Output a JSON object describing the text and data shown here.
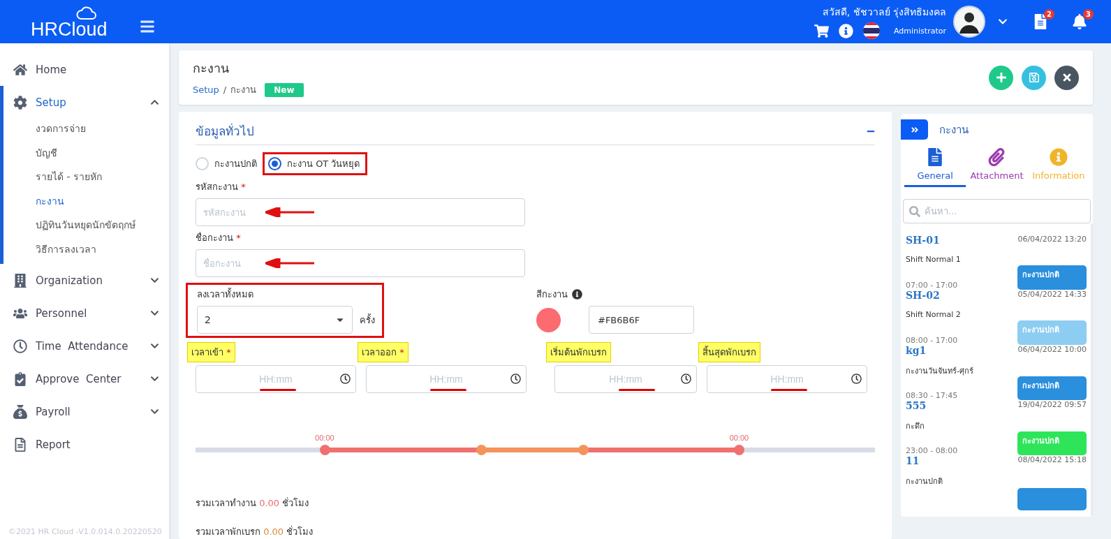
{
  "header": {
    "logo": "HRCloud",
    "greeting": "สวัสดี, ชัชวาลย์ รุ่งสิทธิมงคล",
    "role": "Administrator",
    "documents_badge": "2",
    "notifications_badge": "3"
  },
  "sidebar": {
    "items": [
      {
        "label": "Home",
        "kind": "link"
      },
      {
        "label": "Setup",
        "kind": "group",
        "expanded": true,
        "children": [
          {
            "label": "งวดการจ่าย",
            "selected": false
          },
          {
            "label": "บัญชี",
            "selected": false
          },
          {
            "label": "รายได้ - รายหัก",
            "selected": false
          },
          {
            "label": "กะงาน",
            "selected": true
          },
          {
            "label": "ปฏิทินวันหยุดนักขัตฤกษ์",
            "selected": false
          },
          {
            "label": "วิธีการลงเวลา",
            "selected": false
          }
        ]
      },
      {
        "label": "Organization",
        "kind": "group",
        "expanded": false
      },
      {
        "label": "Personnel",
        "kind": "group",
        "expanded": false
      },
      {
        "label": "Time  Attendance",
        "kind": "group",
        "expanded": false
      },
      {
        "label": "Approve  Center",
        "kind": "group",
        "expanded": false
      },
      {
        "label": "Payroll",
        "kind": "group",
        "expanded": false
      },
      {
        "label": "Report",
        "kind": "link"
      }
    ],
    "copyright": "©2021 HR Cloud -V1.0.014.0.20220520"
  },
  "page": {
    "title": "กะงาน",
    "breadcrumb": [
      "Setup",
      "กะงาน"
    ],
    "breadcrumb_separator": "/",
    "status_badge": "New"
  },
  "form": {
    "section_title": "ข้อมูลทั่วไป",
    "shift_types_boxed": true,
    "shift_types": [
      {
        "label": "กะงานปกติ",
        "selected": false
      },
      {
        "label": "กะงาน OT วันหยุด",
        "selected": true
      }
    ],
    "code": {
      "label": "รหัสกะงาน",
      "required_mark": "*",
      "placeholder": "รหัสกะงาน",
      "arrow": true
    },
    "name": {
      "label": "ชื่อกะงาน",
      "required_mark": "*",
      "placeholder": "ชื่อกะงาน",
      "arrow": true
    },
    "punch_count": {
      "label": "ลงเวลาทั้งหมด",
      "value": "2",
      "unit": "ครั้ง",
      "boxed": true
    },
    "shift_color": {
      "label": "สีกะงาน",
      "color": "#fb6b6f",
      "value": "#FB6B6F"
    },
    "times": [
      {
        "label": "เวลาเข้า",
        "required_mark": "*",
        "placeholder": "HH:mm",
        "highlighted": true
      },
      {
        "label": "เวลาออก",
        "required_mark": "*",
        "placeholder": "HH:mm",
        "highlighted": true
      },
      {
        "label": "เริ่มต้นพักเบรก",
        "placeholder": "HH:mm",
        "highlighted": true
      },
      {
        "label": "สิ้นสุดพักเบรก",
        "placeholder": "HH:mm",
        "highlighted": true
      }
    ],
    "timeline": [
      {
        "level": 0.19,
        "label": "00:00"
      },
      {
        "level": 0.42
      },
      {
        "level": 0.57
      },
      {
        "level": 0.8,
        "label": "00:00"
      }
    ],
    "totals": [
      {
        "label": "รวมเวลาทำงาน",
        "value": "0.00",
        "unit": "ชั่วโมง",
        "color": "#e86b6b"
      },
      {
        "label": "รวมเวลาพักเบรก",
        "value": "0.00",
        "unit": "ชั่วโมง",
        "color": "#d98a3a"
      }
    ]
  },
  "side_panel": {
    "title": "กะงาน",
    "tabs": [
      {
        "label": "General",
        "selected": true,
        "color": "#1a5fd6"
      },
      {
        "label": "Attachment",
        "selected": false,
        "color": "#9b3bb0"
      },
      {
        "label": "Information",
        "selected": false,
        "color": "#f0b429"
      }
    ],
    "search_placeholder": "ค้นหา...",
    "items": [
      {
        "code": "SH-01",
        "date": "06/04/2022 13:20",
        "name": "Shift Normal 1",
        "time": "07:00 - 17:00",
        "tag": {
          "label": "กะงานปกติ",
          "color": "#2a8fdc"
        }
      },
      {
        "code": "SH-02",
        "date": "05/04/2022 14:33",
        "name": "Shift Normal 2",
        "time": "08:00 - 17:00",
        "tag": {
          "label": "กะงานปกติ",
          "color": "#8dcdf2"
        }
      },
      {
        "code": "kg1",
        "date": "06/04/2022 10:00",
        "name": "กะงานวันจันทร์-ศุกร์",
        "time": "08:30 - 17:45",
        "tag": {
          "label": "กะงานปกติ",
          "color": "#2a8fdc"
        }
      },
      {
        "code": "555",
        "date": "19/04/2022 09:57",
        "name": "กะดึก",
        "time": "23:00 - 08:00",
        "tag": {
          "label": "กะงานปกติ",
          "color": "#2ee55a"
        }
      },
      {
        "code": "11",
        "date": "08/04/2022 15:18",
        "name": "กะงานปกติ",
        "tag": {
          "color": "#2a8fdc"
        }
      }
    ]
  }
}
